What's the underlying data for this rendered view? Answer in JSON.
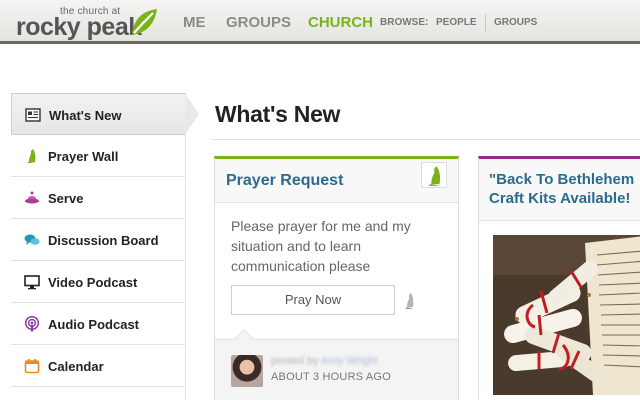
{
  "header": {
    "logo_small": "the church at",
    "logo_big": "rocky peak",
    "nav": [
      "ME",
      "GROUPS",
      "CHURCH"
    ],
    "active_nav": "CHURCH",
    "browse_label": "BROWSE:",
    "browse_links": [
      "PEOPLE",
      "GROUPS"
    ],
    "brand_color": "#7ab317"
  },
  "sidebar": {
    "items": [
      {
        "label": "What's New",
        "icon": "news-icon",
        "active": true
      },
      {
        "label": "Prayer Wall",
        "icon": "praying-hands-icon"
      },
      {
        "label": "Serve",
        "icon": "serve-icon"
      },
      {
        "label": "Discussion Board",
        "icon": "chat-bubbles-icon"
      },
      {
        "label": "Video Podcast",
        "icon": "monitor-icon"
      },
      {
        "label": "Audio Podcast",
        "icon": "podcast-icon"
      },
      {
        "label": "Calendar",
        "icon": "calendar-icon"
      }
    ]
  },
  "main": {
    "title": "What's New",
    "prayer_card": {
      "title": "Prayer Request",
      "text": "Please prayer for me and my situation and to learn communication please",
      "button": "Pray Now",
      "posted_by": "posted by",
      "author": "Amy Wright",
      "time": "ABOUT 3 HOURS AGO",
      "accent": "#7ab317"
    },
    "event_card": {
      "title_line1": "\"Back To Bethlehem",
      "title_line2": "Craft Kits Available!",
      "accent": "#9b2b8b"
    }
  }
}
